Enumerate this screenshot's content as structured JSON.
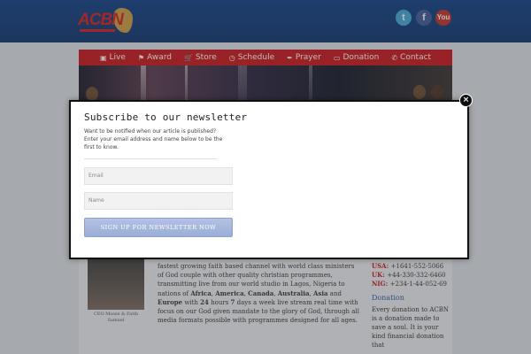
{
  "header": {
    "logo_text": "ACBN",
    "social": [
      "twitter-icon",
      "facebook-icon",
      "youtube-icon"
    ]
  },
  "nav": {
    "items": [
      {
        "label": "Live",
        "icon": "▣"
      },
      {
        "label": "Award",
        "icon": "⚑"
      },
      {
        "label": "Store",
        "icon": "🛒"
      },
      {
        "label": "Schedule",
        "icon": "◷"
      },
      {
        "label": "Prayer",
        "icon": "✒"
      },
      {
        "label": "Donation",
        "icon": "▭"
      },
      {
        "label": "Contact",
        "icon": "✆"
      }
    ]
  },
  "content": {
    "caption": "CEO Moses & Faith Samuel",
    "body_parts": [
      "fastest growing faith based channel with world class ministers of God couple with other quality christian programmes, transmitting live from our world studio in Lagos, Nigeria to nations of ",
      "Africa",
      ", ",
      "America",
      ", ",
      "Canada",
      ", ",
      "Australia",
      ", ",
      "Asia",
      " and ",
      "Europe",
      " with ",
      "24",
      " hours ",
      "7",
      " days a week live stream real time with focus on our God given mandate to the glory of God, through all media formats possible with programmes designed for all ages."
    ]
  },
  "sidebar": {
    "phones": [
      {
        "country": "USA",
        "number": "+1641-552-5066"
      },
      {
        "country": "UK",
        "number": "+44-330-332-6460"
      },
      {
        "country": "NIG",
        "number": "+234-1-44-052-69"
      }
    ],
    "donation_title": "Donation",
    "donation_text": "Every donation to ACBN is a donation made to save a soul. It is your kind financial donation that"
  },
  "modal": {
    "title": "Subscribe to our newsletter",
    "description": "Want to be notified when our article is published? Enter your email address and name below to be the first to know.",
    "email_placeholder": "Email",
    "name_placeholder": "Name",
    "button_label": "SIGN UP FOR NEWSLETTER NOW",
    "close_label": "×"
  }
}
